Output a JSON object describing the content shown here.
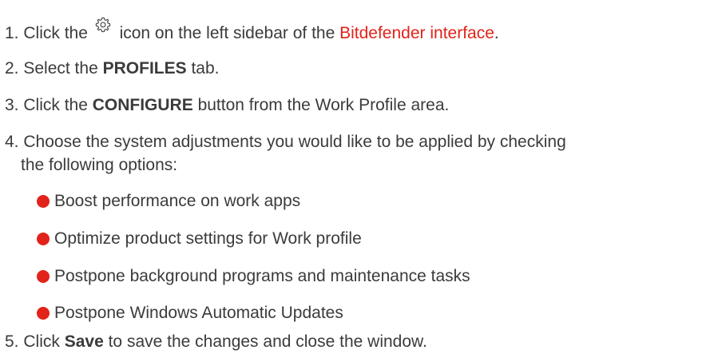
{
  "steps": [
    {
      "num": "1.",
      "pre": "Click the",
      "icon": "gear-icon",
      "mid": "icon on the left sidebar of the",
      "link": "Bitdefender interface",
      "post": "."
    },
    {
      "num": "2.",
      "pre": "Select the",
      "bold": "PROFILES",
      "post": "tab."
    },
    {
      "num": "3.",
      "pre": "Click the",
      "bold": "CONFIGURE",
      "post": "button from the Work Profile area."
    },
    {
      "num": "4.",
      "line1": "Choose the system adjustments you would like to be applied by checking",
      "line2": "the following options:",
      "options": [
        "Boost performance on work apps",
        "Optimize product settings for Work profile",
        "Postpone background programs and maintenance tasks",
        "Postpone Windows Automatic Updates"
      ]
    },
    {
      "num": "5.",
      "pre": "Click",
      "bold": "Save",
      "post": "to save the changes and close the window."
    }
  ],
  "colors": {
    "accent": "#e2231a",
    "text": "#3b3b3b"
  }
}
